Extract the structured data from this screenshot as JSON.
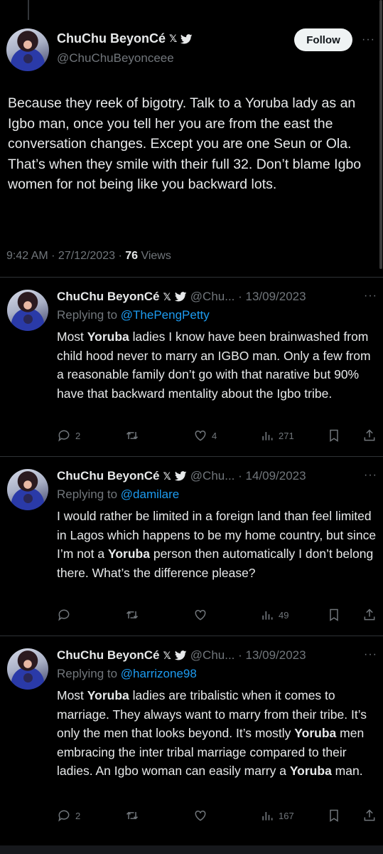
{
  "main_tweet": {
    "display_name": "ChuChu BeyonCé",
    "x_badge": "𝕏",
    "handle": "@ChuChuBeyonceee",
    "follow_label": "Follow",
    "more": "···",
    "text": "Because they reek of bigotry. Talk to a Yoruba lady as an Igbo man, once you tell her you are from the east the conversation changes. Except you are one Seun or Ola. That’s when they smile with their full 32. Don’t blame Igbo women for not being like you backward lots.",
    "time": "9:42 AM · 27/12/2023 · ",
    "views_count": "76",
    "views_label": " Views"
  },
  "replies": [
    {
      "display_name": "ChuChu BeyonCé",
      "x_badge": "𝕏",
      "handle_date": "@Chu... · 13/09/2023",
      "more": "···",
      "replying_label": "Replying to ",
      "replying_to": "@ThePengPetty",
      "text_parts": [
        "Most ",
        "Yoruba",
        " ladies I know have been brainwashed from child hood never to marry an IGBO man. Only a few from a reasonable family don’t go with that narative but 90% have that backward mentality about the Igbo tribe."
      ],
      "replies": "2",
      "retweets": "",
      "likes": "4",
      "views": "271"
    },
    {
      "display_name": "ChuChu BeyonCé",
      "x_badge": "𝕏",
      "handle_date": "@Chu... · 14/09/2023",
      "more": "···",
      "replying_label": "Replying to ",
      "replying_to": "@damilare",
      "text_parts": [
        "I would rather be limited in a foreign land than feel limited in Lagos which happens to be my home country, but since I’m not a ",
        "Yoruba",
        " person then automatically I don’t belong there. What’s the difference please?"
      ],
      "replies": "",
      "retweets": "",
      "likes": "",
      "views": "49"
    },
    {
      "display_name": "ChuChu BeyonCé",
      "x_badge": "𝕏",
      "handle_date": "@Chu... · 13/09/2023",
      "more": "···",
      "replying_label": "Replying to ",
      "replying_to": "@harrizone98",
      "text_parts": [
        "Most ",
        "Yoruba",
        " ladies are tribalistic when it comes to marriage. They always want to marry from their tribe. It’s only the men that looks beyond. It’s mostly ",
        "Yoruba",
        " men embracing the inter tribal marriage compared to their ladies. An Igbo woman can easily marry a ",
        "Yoruba",
        " man."
      ],
      "replies": "2",
      "retweets": "",
      "likes": "",
      "views": "167"
    }
  ],
  "colors": {
    "background": "#000000",
    "text": "#e7e9ea",
    "muted": "#71767b",
    "link": "#1d9bf0",
    "divider": "#2f3336"
  },
  "icons": [
    "verified-bird-icon",
    "reply-icon",
    "retweet-icon",
    "like-icon",
    "views-icon",
    "bookmark-icon",
    "share-icon",
    "more-icon"
  ]
}
